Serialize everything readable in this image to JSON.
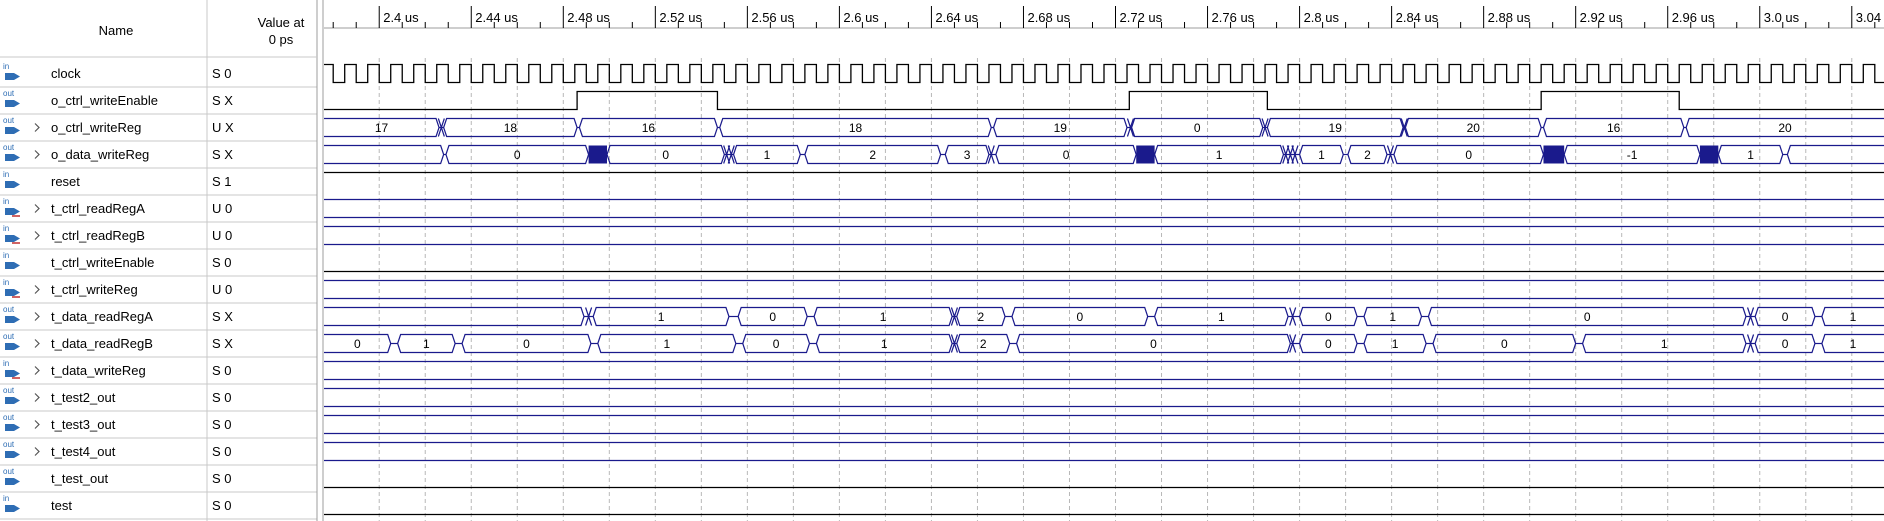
{
  "header": {
    "name_label": "Name",
    "value_label_line1": "Value at",
    "value_label_line2": "0 ps"
  },
  "timeline": {
    "unit": "us",
    "start_us": 2.376,
    "end_us": 3.054,
    "ticks": [
      "2.4 us",
      "2.44 us",
      "2.48 us",
      "2.52 us",
      "2.56 us",
      "2.6 us",
      "2.64 us",
      "2.68 us",
      "2.72 us",
      "2.76 us",
      "2.8 us",
      "2.84 us",
      "2.88 us",
      "2.92 us",
      "2.96 us",
      "3.0 us",
      "3.04 us"
    ],
    "tick_values_us": [
      2.4,
      2.44,
      2.48,
      2.52,
      2.56,
      2.6,
      2.64,
      2.68,
      2.72,
      2.76,
      2.8,
      2.84,
      2.88,
      2.92,
      2.96,
      3.0,
      3.04
    ],
    "clock_half_period_us": 0.005
  },
  "colors": {
    "bus": "#1a1a8c",
    "wire": "#000000",
    "grid": "#b8b8b8",
    "border": "#c8c8c8",
    "panel_line": "#9c9c9c",
    "icon_out": "#2e6db4",
    "icon_in": "#2e6db4"
  },
  "signals": [
    {
      "name": "clock",
      "dir": "in",
      "bus": false,
      "value": "S 0",
      "kind": "clock"
    },
    {
      "name": "o_ctrl_writeEnable",
      "dir": "out",
      "bus": false,
      "value": "S X",
      "kind": "bit",
      "init": 0,
      "changes": [
        [
          2.486,
          1
        ],
        [
          2.547,
          0
        ],
        [
          2.726,
          1
        ],
        [
          2.786,
          0
        ],
        [
          2.905,
          1
        ],
        [
          2.965,
          0
        ]
      ]
    },
    {
      "name": "o_ctrl_writeReg",
      "dir": "out",
      "bus": true,
      "value": "U X",
      "kind": "bus",
      "segments": [
        [
          2.376,
          2.426,
          "17"
        ],
        [
          2.428,
          2.486,
          "18"
        ],
        [
          2.487,
          2.547,
          "16"
        ],
        [
          2.548,
          2.666,
          "18"
        ],
        [
          2.667,
          2.725,
          "19"
        ],
        [
          2.727,
          2.784,
          "0"
        ],
        [
          2.786,
          2.845,
          "19"
        ],
        [
          2.846,
          2.905,
          "20"
        ],
        [
          2.906,
          2.967,
          "16"
        ],
        [
          2.968,
          3.054,
          "20"
        ]
      ],
      "glitches": [
        2.427,
        2.7265,
        2.785,
        2.8455
      ]
    },
    {
      "name": "o_data_writeReg",
      "dir": "out",
      "bus": true,
      "value": "S X",
      "kind": "bus",
      "segments": [
        [
          2.376,
          2.428,
          ""
        ],
        [
          2.429,
          2.491,
          "0"
        ],
        [
          2.499,
          2.55,
          "0"
        ],
        [
          2.554,
          2.583,
          "1"
        ],
        [
          2.585,
          2.644,
          "2"
        ],
        [
          2.646,
          2.665,
          "3"
        ],
        [
          2.668,
          2.729,
          "0"
        ],
        [
          2.737,
          2.793,
          "1"
        ],
        [
          2.8,
          2.819,
          "1"
        ],
        [
          2.821,
          2.838,
          "2"
        ],
        [
          2.841,
          2.906,
          "0"
        ],
        [
          2.915,
          2.974,
          "-1"
        ],
        [
          2.982,
          3.01,
          "1"
        ],
        [
          3.012,
          3.054,
          ""
        ]
      ],
      "solid": [
        [
          2.491,
          2.499
        ],
        [
          2.729,
          2.737
        ],
        [
          2.906,
          2.915
        ],
        [
          2.974,
          2.982
        ]
      ],
      "glitches": [
        2.551,
        2.553,
        2.666,
        2.794,
        2.796,
        2.798,
        2.8395
      ]
    },
    {
      "name": "reset",
      "dir": "in",
      "bus": false,
      "value": "S 1",
      "kind": "bit",
      "init": 1,
      "changes": []
    },
    {
      "name": "t_ctrl_readRegA",
      "dir": "in",
      "bus": true,
      "value": "U 0",
      "kind": "bus",
      "segments": [
        [
          2.376,
          3.054,
          ""
        ]
      ]
    },
    {
      "name": "t_ctrl_readRegB",
      "dir": "in",
      "bus": true,
      "value": "U 0",
      "kind": "bus",
      "segments": [
        [
          2.376,
          3.054,
          ""
        ]
      ]
    },
    {
      "name": "t_ctrl_writeEnable",
      "dir": "in",
      "bus": false,
      "value": "S 0",
      "kind": "bit",
      "init": 0,
      "changes": []
    },
    {
      "name": "t_ctrl_writeReg",
      "dir": "in",
      "bus": true,
      "value": "U 0",
      "kind": "bus",
      "segments": [
        [
          2.376,
          3.054,
          ""
        ]
      ]
    },
    {
      "name": "t_data_readRegA",
      "dir": "out",
      "bus": true,
      "value": "S X",
      "kind": "bus",
      "segments": [
        [
          2.376,
          2.489,
          ""
        ],
        [
          2.493,
          2.552,
          "1"
        ],
        [
          2.556,
          2.586,
          "0"
        ],
        [
          2.589,
          2.649,
          "1"
        ],
        [
          2.651,
          2.672,
          "2"
        ],
        [
          2.675,
          2.734,
          "0"
        ],
        [
          2.737,
          2.795,
          "1"
        ],
        [
          2.8,
          2.825,
          "0"
        ],
        [
          2.828,
          2.853,
          "1"
        ],
        [
          2.856,
          2.994,
          "0"
        ],
        [
          2.998,
          3.024,
          "0"
        ],
        [
          3.027,
          3.054,
          "1"
        ]
      ],
      "glitches": [
        2.491,
        2.65,
        2.797,
        2.996
      ]
    },
    {
      "name": "t_data_readRegB",
      "dir": "out",
      "bus": true,
      "value": "S X",
      "kind": "bus",
      "segments": [
        [
          2.376,
          2.405,
          "0"
        ],
        [
          2.408,
          2.433,
          "1"
        ],
        [
          2.436,
          2.492,
          "0"
        ],
        [
          2.495,
          2.555,
          "1"
        ],
        [
          2.558,
          2.587,
          "0"
        ],
        [
          2.59,
          2.649,
          "1"
        ],
        [
          2.651,
          2.674,
          "2"
        ],
        [
          2.677,
          2.796,
          "0"
        ],
        [
          2.8,
          2.825,
          "0"
        ],
        [
          2.828,
          2.855,
          "1"
        ],
        [
          2.858,
          2.92,
          "0"
        ],
        [
          2.923,
          2.994,
          "1"
        ],
        [
          2.998,
          3.024,
          "0"
        ],
        [
          3.027,
          3.054,
          "1"
        ]
      ],
      "glitches": [
        2.65,
        2.797,
        2.996
      ]
    },
    {
      "name": "t_data_writeReg",
      "dir": "in",
      "bus": true,
      "value": "S 0",
      "kind": "bus",
      "segments": [
        [
          2.376,
          3.054,
          ""
        ]
      ]
    },
    {
      "name": "t_test2_out",
      "dir": "out",
      "bus": true,
      "value": "S 0",
      "kind": "bus",
      "segments": [
        [
          2.376,
          3.054,
          ""
        ]
      ]
    },
    {
      "name": "t_test3_out",
      "dir": "out",
      "bus": true,
      "value": "S 0",
      "kind": "bus",
      "segments": [
        [
          2.376,
          3.054,
          ""
        ]
      ]
    },
    {
      "name": "t_test4_out",
      "dir": "out",
      "bus": true,
      "value": "S 0",
      "kind": "bus",
      "segments": [
        [
          2.376,
          3.054,
          ""
        ]
      ]
    },
    {
      "name": "t_test_out",
      "dir": "out",
      "bus": false,
      "value": "S 0",
      "kind": "bit",
      "init": 0,
      "changes": []
    },
    {
      "name": "test",
      "dir": "in",
      "bus": false,
      "value": "S 0",
      "kind": "bit",
      "init": 0,
      "changes": []
    }
  ]
}
